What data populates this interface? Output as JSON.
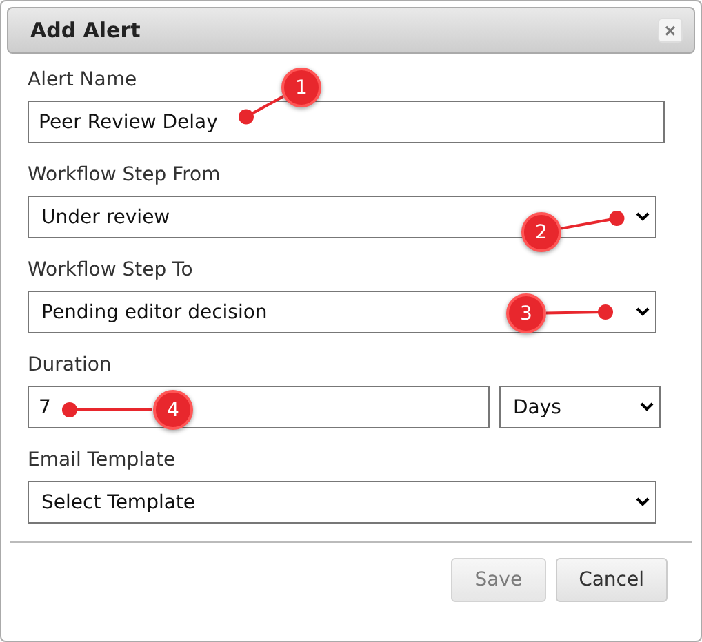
{
  "dialog": {
    "title": "Add Alert",
    "close": "×"
  },
  "fields": [
    {
      "kind": "text",
      "label": "Alert Name",
      "value": "Peer Review Delay"
    },
    {
      "kind": "select",
      "label": "Workflow Step From",
      "value": "Under review"
    },
    {
      "kind": "select",
      "label": "Workflow Step To",
      "value": "Pending editor decision"
    },
    {
      "kind": "duration",
      "label": "Duration",
      "value": "7",
      "unit": "Days"
    },
    {
      "kind": "select",
      "label": "Email Template",
      "value": "Select Template"
    }
  ],
  "buttons": [
    {
      "label": "Save",
      "disabled": true
    },
    {
      "label": "Cancel",
      "disabled": false
    }
  ],
  "annotations": [
    {
      "label": "1"
    },
    {
      "label": "2"
    },
    {
      "label": "3"
    },
    {
      "label": "4"
    }
  ]
}
